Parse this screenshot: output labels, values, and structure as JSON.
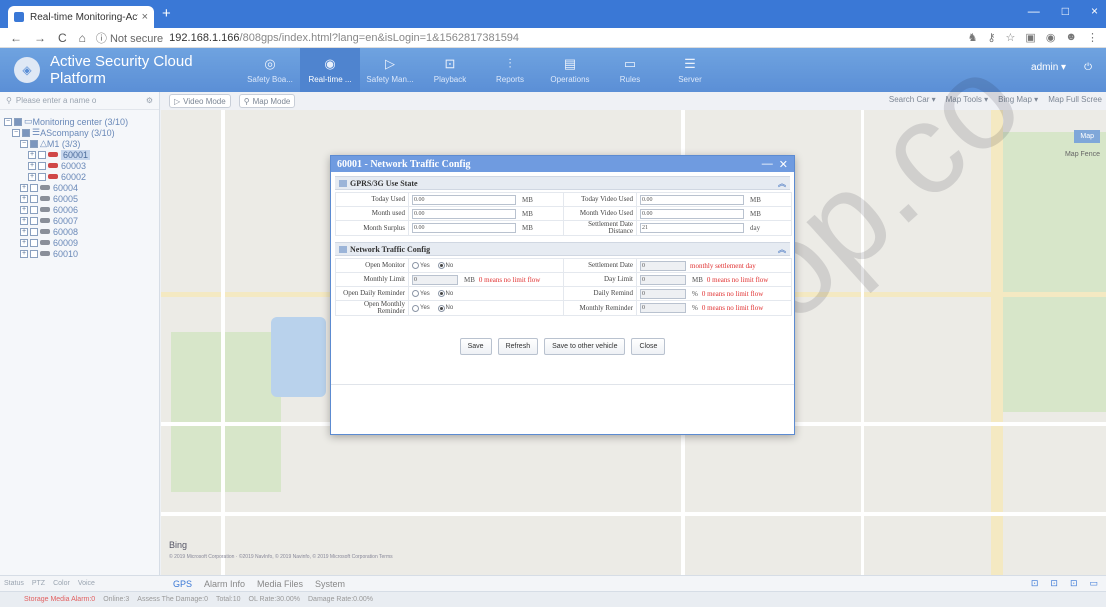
{
  "browser": {
    "tab_title": "Real-time Monitoring-Active !",
    "tab_close": "×",
    "new_tab": "+",
    "window_controls": [
      "—",
      "□",
      "×"
    ],
    "nav": [
      "←",
      "→",
      "C",
      "⌂"
    ],
    "secure_label": "ⓘ Not secure",
    "url_host": "192.168.1.166",
    "url_path": "/808gps/index.html?lang=en&isLogin=1&1562817381594"
  },
  "app": {
    "title": "Active Security Cloud Platform",
    "nav": [
      {
        "label": "Safety Boa...",
        "icon": "◎"
      },
      {
        "label": "Real-time ...",
        "icon": "◉"
      },
      {
        "label": "Safety Man...",
        "icon": "▷"
      },
      {
        "label": "Playback",
        "icon": "⊡"
      },
      {
        "label": "Reports",
        "icon": "⫶"
      },
      {
        "label": "Operations",
        "icon": "▤"
      },
      {
        "label": "Rules",
        "icon": "▭"
      },
      {
        "label": "Server",
        "icon": "☰"
      }
    ],
    "user": "admin ▾",
    "power_icon": "⏻"
  },
  "left": {
    "search_placeholder": "Please enter a name o",
    "tree": {
      "root": "Monitoring center (3/10)",
      "company": "AScompany (3/10)",
      "group": "M1 (3/3)",
      "vehicles": [
        "60001",
        "60003",
        "60002",
        "60004",
        "60005",
        "60006",
        "60007",
        "60008",
        "60009",
        "60010"
      ]
    }
  },
  "map": {
    "video_mode": "Video Mode",
    "map_mode": "Map Mode",
    "tools": [
      "Search Car ▾",
      "Map Tools ▾",
      "Bing Map ▾",
      "Map Full Scree"
    ],
    "map_types": [
      "Map",
      "Map Fence"
    ],
    "bing_label": "Bing",
    "copyright": "© 2019 Microsoft Corporation · ©2019 NavInfo, © 2019 Navinfo, © 2019 Microsoft Corporation  Terms"
  },
  "watermark": "shop.co",
  "bottom": {
    "left_tabs": [
      "Status",
      "PTZ",
      "Color",
      "Voice"
    ],
    "tabs": [
      "GPS",
      "Alarm Info",
      "Media Files",
      "System"
    ],
    "icons": [
      "⊡",
      "⊡",
      "⊡",
      "▭"
    ]
  },
  "statusbar": {
    "alarm": "Storage Media Alarm:0",
    "online": "Online:3",
    "assess": "Assess The Damage:0",
    "total": "Total:10",
    "ol_rate": "OL Rate:30.00%",
    "damage_rate": "Damage Rate:0.00%"
  },
  "dialog": {
    "title": "60001 - Network Traffic Config",
    "controls": [
      "—",
      "✕"
    ],
    "section1": "GPRS/3G Use State",
    "section2": "Network Traffic Config",
    "collapse_icon": "︽",
    "usage": [
      {
        "label": "Today Used",
        "value": "0.00",
        "unit": "MB",
        "label2": "Today Video Used",
        "value2": "0.00",
        "unit2": "MB"
      },
      {
        "label": "Month used",
        "value": "0.00",
        "unit": "MB",
        "label2": "Month Video Used",
        "value2": "0.00",
        "unit2": "MB"
      },
      {
        "label": "Month Surplus",
        "value": "0.00",
        "unit": "MB",
        "label2": "Settlement Date Distance",
        "value2": "21",
        "unit2": "day"
      }
    ],
    "config": {
      "open_monitor_label": "Open Monitor",
      "yes": "Yes",
      "no": "No",
      "settlement_date_label": "Settlement Date",
      "settlement_date_value": "0",
      "settlement_hint": "monthly settlement day",
      "monthly_limit_label": "Monthly Limit",
      "monthly_limit_value": "0",
      "mb": "MB",
      "no_limit_hint": "0 means no limit flow",
      "day_limit_label": "Day Limit",
      "day_limit_value": "0",
      "open_daily_label": "Open Daily Reminder",
      "daily_remind_label": "Daily Remind",
      "daily_remind_value": "0",
      "percent": "%",
      "open_monthly_label": "Open Monthly Reminder",
      "monthly_reminder_label": "Monthly Reminder",
      "monthly_reminder_value": "0"
    },
    "buttons": [
      "Save",
      "Refresh",
      "Save to other vehicle",
      "Close"
    ]
  }
}
